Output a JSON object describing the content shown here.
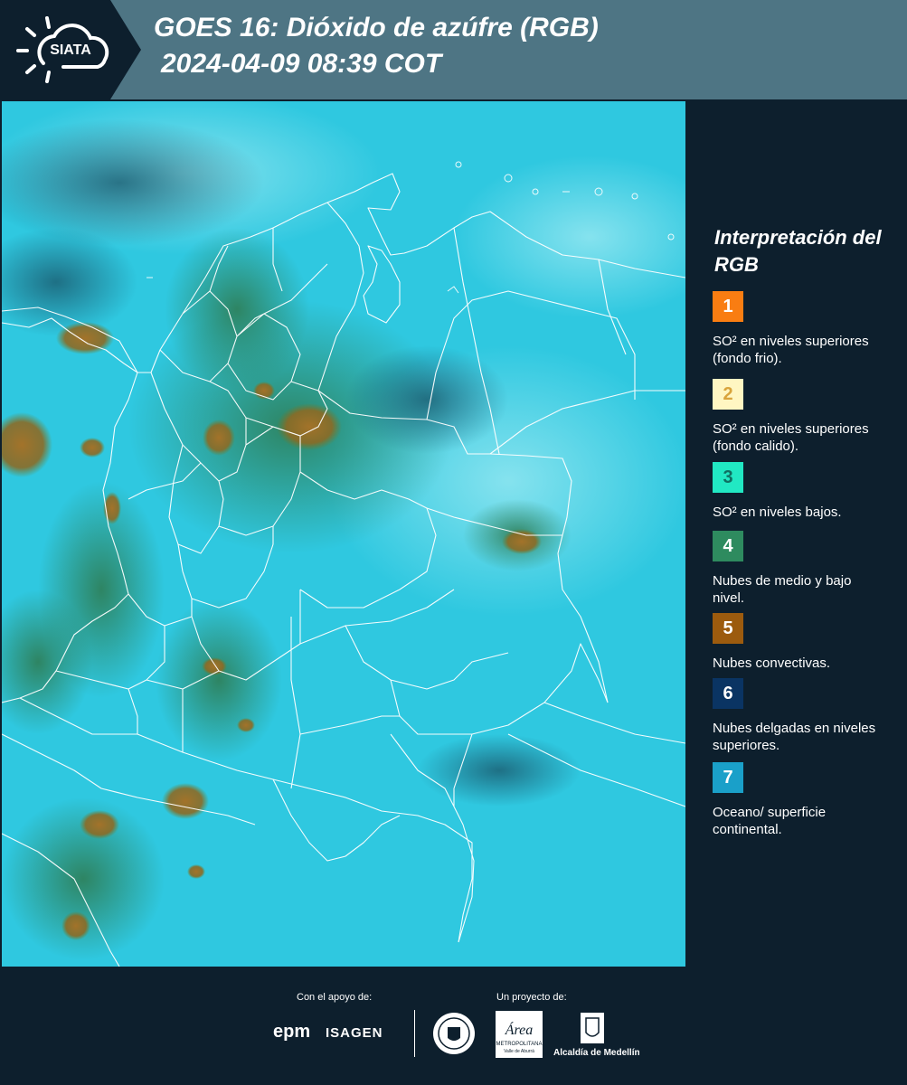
{
  "header": {
    "logo_text": "SIATA",
    "title_line1": "GOES 16: Dióxido de azúfre (RGB)",
    "title_line2": "2024-04-09 08:39 COT"
  },
  "legend": {
    "title": "Interpretación del RGB",
    "items": [
      {
        "number": "1",
        "color": "#f97d12",
        "number_color": "#ffffff",
        "text": "SO² en niveles superiores (fondo frio)."
      },
      {
        "number": "2",
        "color": "#fff6c2",
        "number_color": "#d9a43c",
        "text": "SO² en niveles superiores (fondo calido)."
      },
      {
        "number": "3",
        "color": "#21e8c3",
        "number_color": "#0f6e61",
        "text": "SO² en niveles bajos."
      },
      {
        "number": "4",
        "color": "#2e8b5f",
        "number_color": "#ffffff",
        "text": "Nubes de medio y bajo nivel."
      },
      {
        "number": "5",
        "color": "#9c5b0e",
        "number_color": "#ffffff",
        "text": "Nubes convectivas."
      },
      {
        "number": "6",
        "color": "#0a3463",
        "number_color": "#ffffff",
        "text": "Nubes delgadas en niveles superiores."
      },
      {
        "number": "7",
        "color": "#1aa0c9",
        "number_color": "#ffffff",
        "text": "Oceano/ superficie continental."
      }
    ]
  },
  "footer": {
    "support_label": "Con el apoyo de:",
    "project_label": "Un proyecto de:",
    "epm": "epm",
    "isagen": "ISAGEN",
    "area_name": "Área",
    "area_subtitle": "METROPOLITANA",
    "area_subtitle2": "Valle de Aburrá",
    "alcaldia": "Alcaldía de Medellín"
  },
  "colors": {
    "background": "#0d1f2d",
    "header_band": "#4e7584",
    "map_base": "#2fc8e0",
    "cloud_green": "#2e8b5f",
    "cloud_brown": "#9c6b1e"
  }
}
